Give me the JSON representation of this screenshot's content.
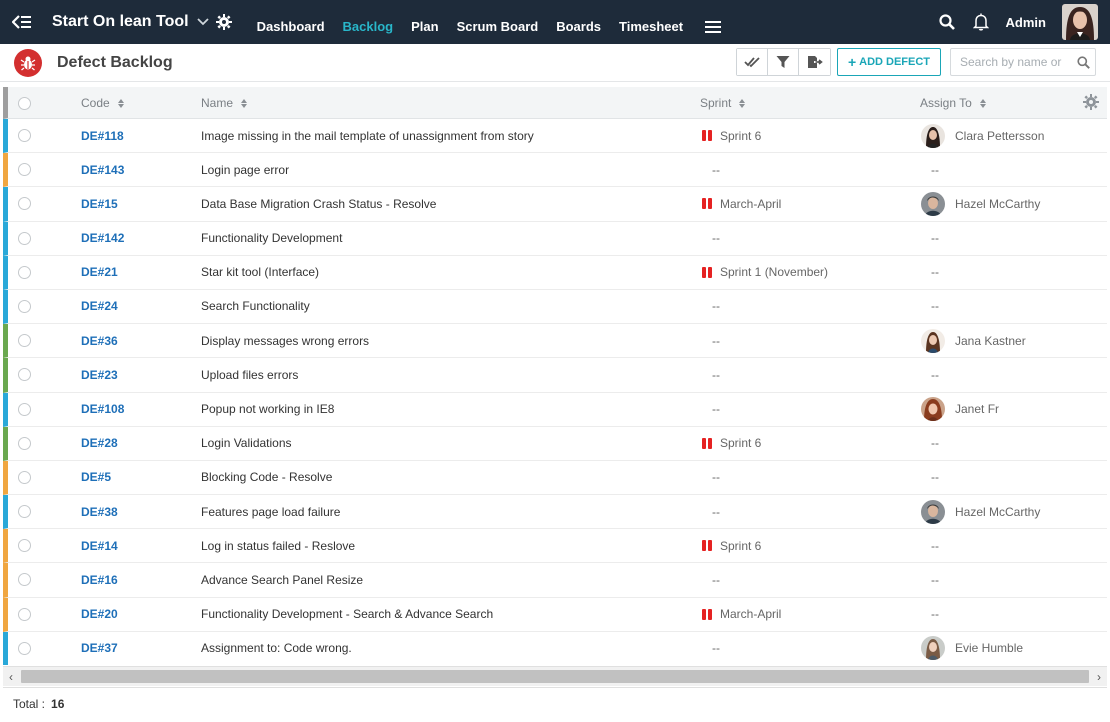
{
  "topbar": {
    "app_title": "Start On lean Tool",
    "nav": [
      "Dashboard",
      "Backlog",
      "Plan",
      "Scrum Board",
      "Boards",
      "Timesheet"
    ],
    "active_nav": "Backlog",
    "user": "Admin"
  },
  "page": {
    "title": "Defect Backlog",
    "add_label": "ADD DEFECT",
    "search_placeholder": "Search by name or"
  },
  "columns": {
    "code": "Code",
    "name": "Name",
    "sprint": "Sprint",
    "assign": "Assign To"
  },
  "rows": [
    {
      "code": "DE#118",
      "name": "Image missing in the mail template of unassignment from story",
      "sprint": "Sprint 6",
      "assign": "Clara Pettersson",
      "color": "#29a8d8",
      "avatar": "woman-dark-hair"
    },
    {
      "code": "DE#143",
      "name": "Login page error",
      "sprint": "--",
      "assign": "--",
      "color": "#f0a640"
    },
    {
      "code": "DE#15",
      "name": "Data Base Migration Crash Status - Resolve",
      "sprint": "March-April",
      "assign": "Hazel McCarthy",
      "color": "#29a8d8",
      "avatar": "man-grey"
    },
    {
      "code": "DE#142",
      "name": "Functionality Development",
      "sprint": "--",
      "assign": "--",
      "color": "#29a8d8"
    },
    {
      "code": "DE#21",
      "name": "Star kit tool (Interface)",
      "sprint": "Sprint 1 (November)",
      "assign": "--",
      "color": "#29a8d8"
    },
    {
      "code": "DE#24",
      "name": "Search Functionality",
      "sprint": "--",
      "assign": "--",
      "color": "#29a8d8"
    },
    {
      "code": "DE#36",
      "name": "Display messages wrong errors",
      "sprint": "--",
      "assign": "Jana Kastner",
      "color": "#6aa84f",
      "avatar": "woman-brown"
    },
    {
      "code": "DE#23",
      "name": "Upload files errors",
      "sprint": "--",
      "assign": "--",
      "color": "#6aa84f"
    },
    {
      "code": "DE#108",
      "name": "Popup not working in IE8",
      "sprint": "--",
      "assign": "Janet Fr",
      "color": "#29a8d8",
      "avatar": "woman-red"
    },
    {
      "code": "DE#28",
      "name": "Login Validations",
      "sprint": "Sprint 6",
      "assign": "--",
      "color": "#6aa84f"
    },
    {
      "code": "DE#5",
      "name": "Blocking Code - Resolve",
      "sprint": "--",
      "assign": "--",
      "color": "#f0a640"
    },
    {
      "code": "DE#38",
      "name": "Features page load failure",
      "sprint": "--",
      "assign": "Hazel McCarthy",
      "color": "#29a8d8",
      "avatar": "man-grey"
    },
    {
      "code": "DE#14",
      "name": "Log in status failed - Reslove",
      "sprint": "Sprint 6",
      "assign": "--",
      "color": "#f0a640"
    },
    {
      "code": "DE#16",
      "name": "Advance Search Panel Resize",
      "sprint": "--",
      "assign": "--",
      "color": "#f0a640"
    },
    {
      "code": "DE#20",
      "name": "Functionality Development - Search & Advance Search",
      "sprint": "March-April",
      "assign": "--",
      "color": "#f0a640"
    },
    {
      "code": "DE#37",
      "name": "Assignment to: Code wrong.",
      "sprint": "--",
      "assign": "Evie Humble",
      "color": "#29a8d8",
      "avatar": "woman-light"
    }
  ],
  "footer": {
    "total_label": "Total :",
    "total_value": "16"
  },
  "colors": {
    "navbar": "#1e2b3a",
    "accent": "#1aa6b7",
    "active_nav": "#29b6c9",
    "sprint_icon": "#e52222",
    "bug_badge": "#d32f2f",
    "code_link": "#1e6fb8"
  }
}
